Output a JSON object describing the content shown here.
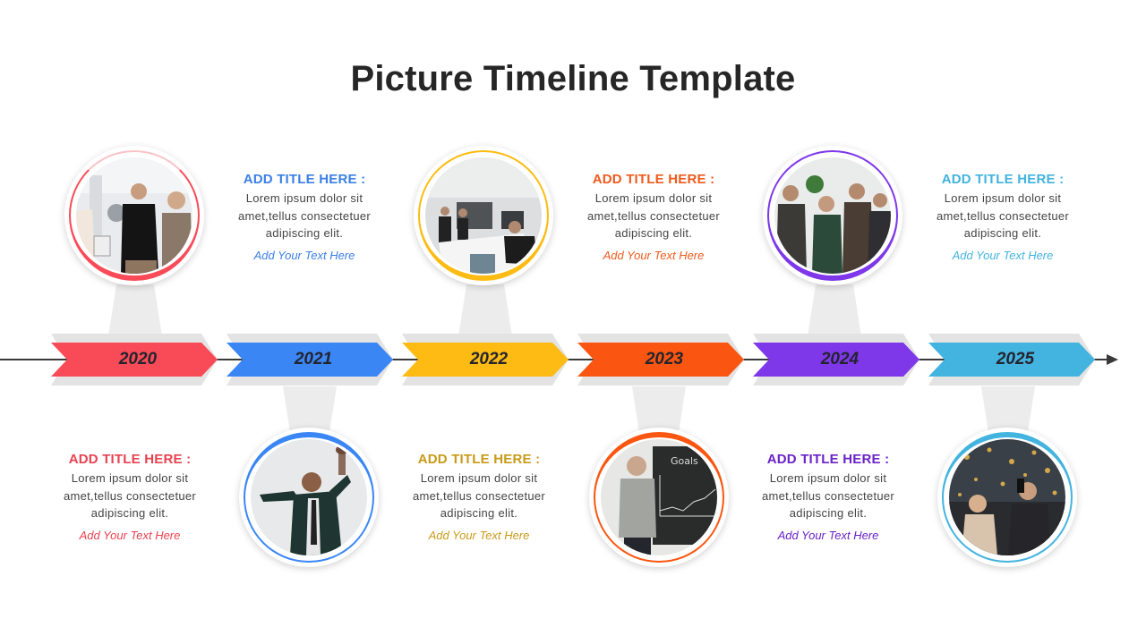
{
  "title": "Picture Timeline Template",
  "milestones": [
    {
      "year": "2020",
      "color": "#f94b57",
      "text_color": "#e8424f",
      "position": "photo-top",
      "photo": "team-celebrating-office",
      "title": "ADD TITLE HERE :",
      "body": "Lorem ipsum dolor sit amet,tellus consectetuer adipiscing elit.",
      "link": "Add Your Text Here"
    },
    {
      "year": "2021",
      "color": "#3b86f5",
      "text_color": "#3b7fe6",
      "position": "photo-bottom",
      "photo": "businessman-with-trophy",
      "title": "ADD TITLE HERE :",
      "body": "Lorem ipsum dolor sit amet,tellus consectetuer adipiscing elit.",
      "link": "Add Your Text Here"
    },
    {
      "year": "2022",
      "color": "#fdbb13",
      "text_color": "#c99a18",
      "position": "photo-top",
      "photo": "meeting-room-presentation",
      "title": "ADD TITLE HERE :",
      "body": "Lorem ipsum dolor sit amet,tellus consectetuer adipiscing elit.",
      "link": "Add Your Text Here"
    },
    {
      "year": "2023",
      "color": "#fb5611",
      "text_color": "#ef5a1c",
      "position": "photo-bottom",
      "photo": "man-at-chalkboard-goals",
      "title": "ADD TITLE HERE :",
      "body": "Lorem ipsum dolor sit amet,tellus consectetuer adipiscing elit.",
      "link": "Add Your Text Here"
    },
    {
      "year": "2024",
      "color": "#7f37ea",
      "text_color": "#6a22c9",
      "position": "photo-top",
      "photo": "team-applauding",
      "title": "ADD TITLE HERE :",
      "body": "Lorem ipsum dolor sit amet,tellus consectetuer adipiscing elit.",
      "link": "Add Your Text Here"
    },
    {
      "year": "2025",
      "color": "#43b3df",
      "text_color": "#43b3df",
      "position": "photo-bottom",
      "photo": "confetti-celebration",
      "title": "ADD TITLE HERE :",
      "body": "Lorem ipsum dolor sit amet,tellus consectetuer adipiscing elit.",
      "link": "Add Your Text Here"
    }
  ]
}
